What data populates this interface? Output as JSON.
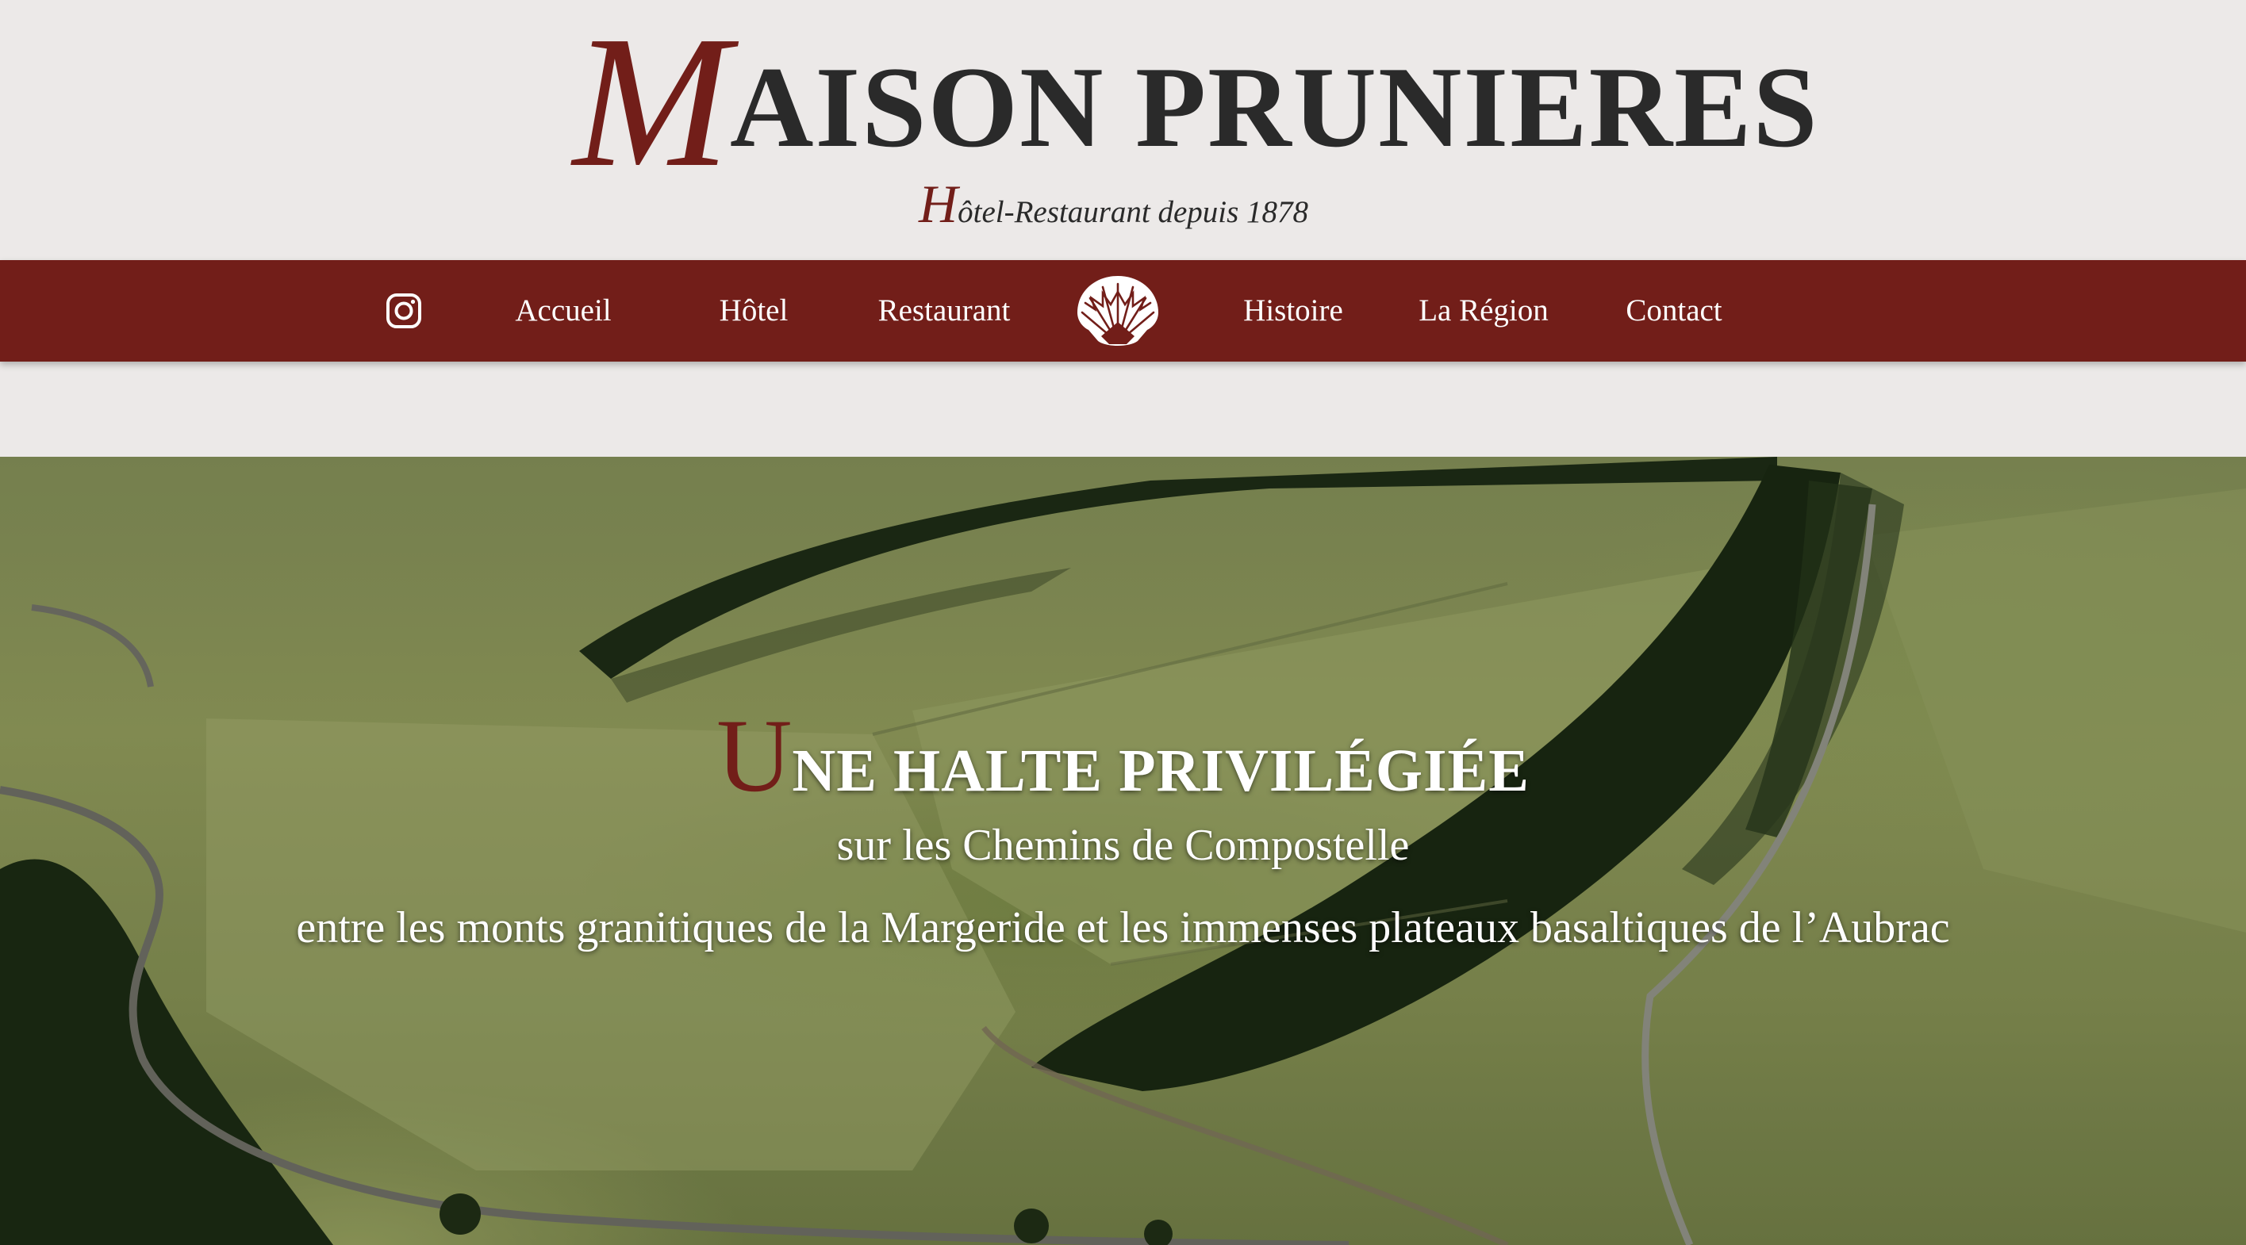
{
  "brand": {
    "initial": "M",
    "rest": "AISON PRUNIERES",
    "tagline_initial": "H",
    "tagline_rest": "ôtel-Restaurant depuis 1878"
  },
  "nav": {
    "items": [
      "Accueil",
      "Hôtel",
      "Restaurant",
      "Histoire",
      "La Région",
      "Contact"
    ],
    "instagram_icon": "instagram-icon",
    "emblem_icon": "scallop-shell-icon"
  },
  "hero": {
    "headline_initial": "U",
    "headline_rest": "NE HALTE PRIVILÉGIÉE",
    "subtitle": "sur les Chemins de Compostelle",
    "description": "entre les monts granitiques de la Margeride et les immenses plateaux basaltiques de l’Aubrac"
  },
  "colors": {
    "accent": "#721e19",
    "background": "#ece9e8",
    "text_dark": "#2a2a2a"
  }
}
